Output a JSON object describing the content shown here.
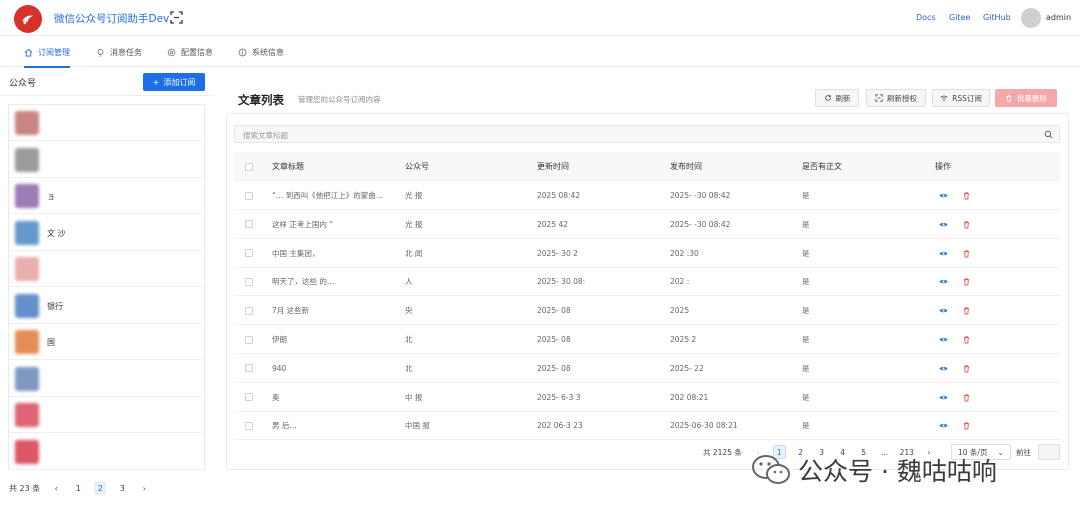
{
  "header": {
    "app_title": "微信公众号订阅助手Dev",
    "links": [
      "Docs",
      "Gitee",
      "GitHub"
    ],
    "user": "admin"
  },
  "tabs": [
    {
      "label": "订阅管理",
      "icon": "home-icon",
      "active": true
    },
    {
      "label": "消息任务",
      "icon": "bulb-icon",
      "active": false
    },
    {
      "label": "配置信息",
      "icon": "settings-icon",
      "active": false
    },
    {
      "label": "系统信息",
      "icon": "info-icon",
      "active": false
    }
  ],
  "sidebar": {
    "title": "公众号",
    "add_button": "添加订阅",
    "accounts": [
      {
        "name": "",
        "color": "#c0706a"
      },
      {
        "name": "",
        "color": "#8a8a8a"
      },
      {
        "name": "ョ",
        "color": "#8a66a8"
      },
      {
        "name": "文 沙",
        "color": "#4a88c4"
      },
      {
        "name": "",
        "color": "#e7a0a0"
      },
      {
        "name": "银行",
        "color": "#4a7cc0"
      },
      {
        "name": "国",
        "color": "#e07a3a"
      },
      {
        "name": "",
        "color": "#6a86b8"
      },
      {
        "name": "",
        "color": "#d84a5a"
      },
      {
        "name": "",
        "color": "#d43a4a"
      }
    ],
    "pager": {
      "total": "共 23 条",
      "pages": [
        "1",
        "2",
        "3"
      ],
      "current": "2"
    }
  },
  "main": {
    "title": "文章列表",
    "subtitle": "管理您的公众号订阅内容",
    "buttons": {
      "refresh": "刷新",
      "refresh_auth": "刷新授权",
      "rss": "RSS订阅",
      "batch_delete": "批量删除"
    },
    "search_placeholder": "搜索文章标题",
    "columns": [
      "文章标题",
      "公众号",
      "更新时间",
      "发布时间",
      "是否有正文",
      "操作"
    ],
    "rows": [
      {
        "title": "“…  到西叫《他把江上》的蒙曲…",
        "account": "光 报",
        "updated": "2025 08:42",
        "published": "2025- -30 08:42",
        "has_body": "是"
      },
      {
        "title": "这样 正考上国内 “",
        "account": "光 报",
        "updated": "2025 42",
        "published": "2025- -30 08:42",
        "has_body": "是"
      },
      {
        "title": "中国 主集团，",
        "account": "北 闻",
        "updated": "2025- 30 2",
        "published": "202 :30",
        "has_body": "是"
      },
      {
        "title": "明天了，这些 的…",
        "account": "人",
        "updated": "2025- 30 08:",
        "published": "202 :",
        "has_body": "是"
      },
      {
        "title": "7月 这些新",
        "account": "央",
        "updated": "2025- 08",
        "published": "2025",
        "has_body": "是"
      },
      {
        "title": "伊朗",
        "account": "北",
        "updated": "2025- 08",
        "published": "2025 2",
        "has_body": "是"
      },
      {
        "title": "940",
        "account": "北",
        "updated": "2025- 08",
        "published": "2025- 22",
        "has_body": "是"
      },
      {
        "title": "奥",
        "account": "中 报",
        "updated": "2025- 6-3 3",
        "published": "202 08:21",
        "has_body": "是"
      },
      {
        "title": "男 后… ",
        "account": "中国 报",
        "updated": "202 06-3 23",
        "published": "2025-06-30 08:21",
        "has_body": "是"
      }
    ],
    "pager": {
      "total": "共 2125 条",
      "pages": [
        "1",
        "2",
        "3",
        "4",
        "5",
        "…",
        "213"
      ],
      "current": "1",
      "page_size": "10 条/页",
      "goto_label": "前往"
    }
  },
  "watermark": "公众号 · 魏咕咕响"
}
